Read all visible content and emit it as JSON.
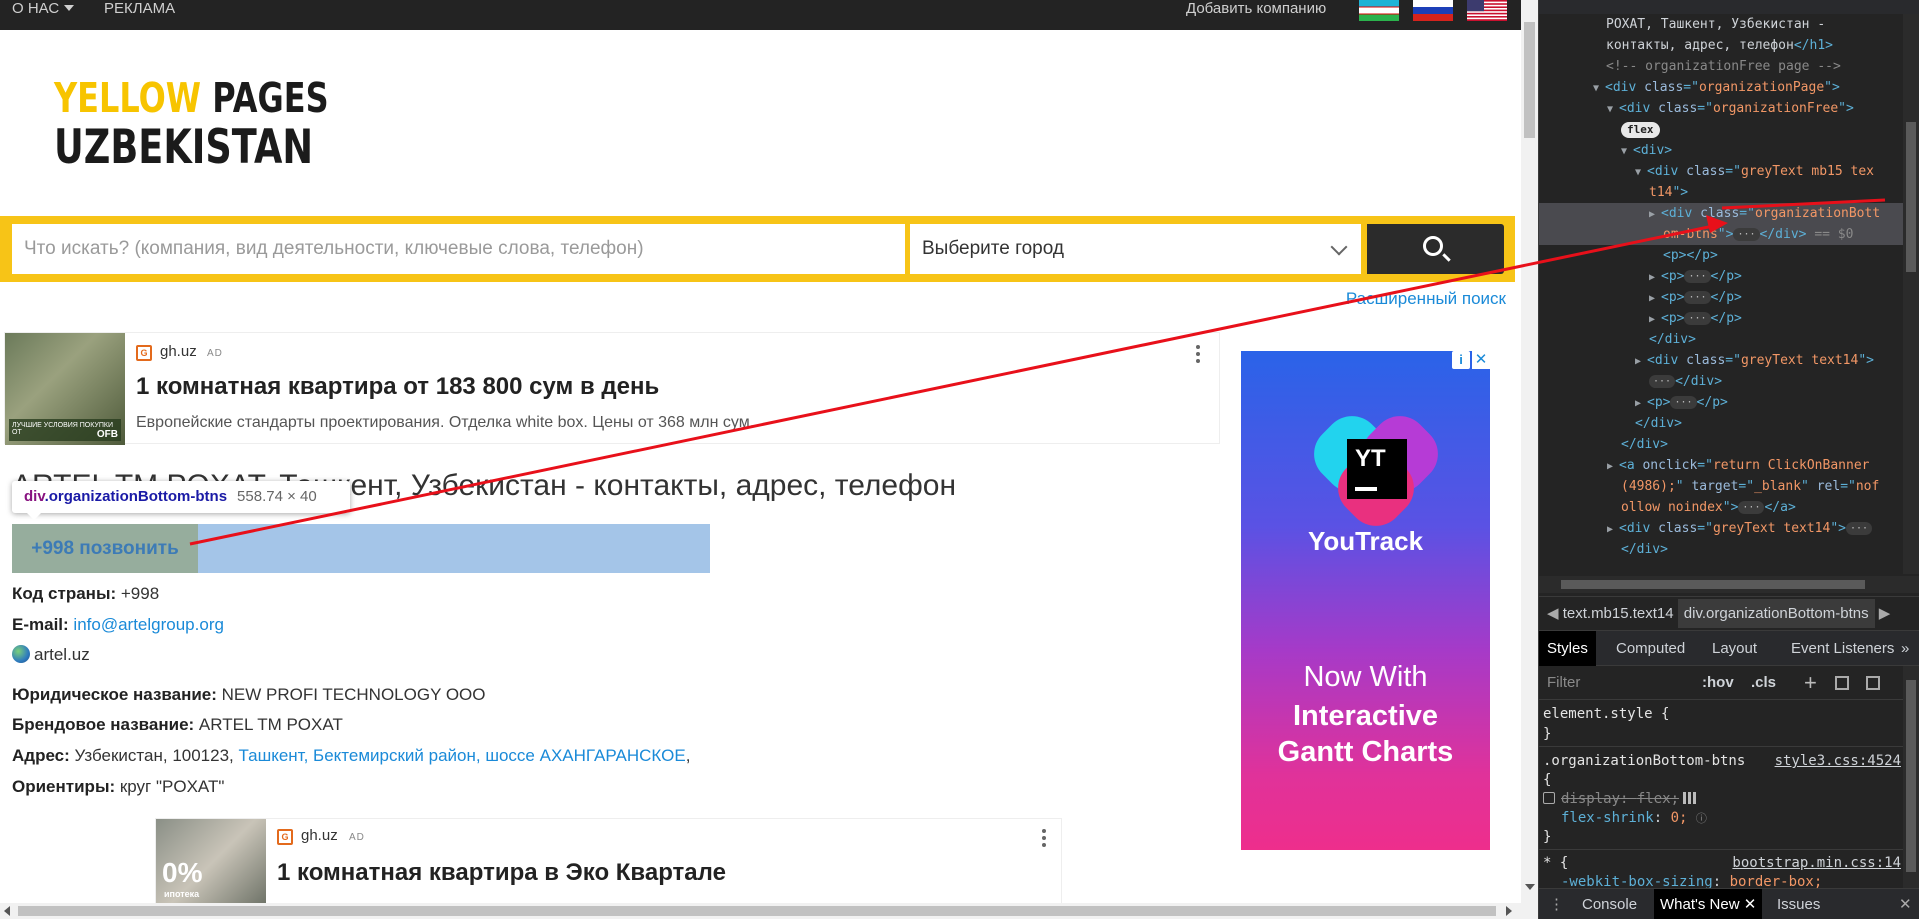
{
  "topbar": {
    "nav_about": "О НАС",
    "nav_ads": "РЕКЛАМА",
    "add_company": "Добавить компанию"
  },
  "logo": {
    "line1_a": "YELLOW",
    "line1_b": "PAGES",
    "line2": "UZBEKISTAN"
  },
  "search": {
    "placeholder": "Что искать? (компания, вид деятельности, ключевые слова, телефон)",
    "city_placeholder": "Выберите город",
    "advanced": "Расширенный поиск"
  },
  "ad_top": {
    "domain": "gh.uz",
    "ad_tag": "AD",
    "title": "1 комнатная квартира от 183 800 сум в день",
    "description": "Европейские стандарты проектирования. Отделка white box. Цены от 368 млн сум.",
    "thumb_caption": "ЛУЧШИЕ УСЛОВИЯ ПОКУПКИ ОТ",
    "thumb_brand": "OFB"
  },
  "company": {
    "heading": "ARTEL TM POXAT, Ташкент, Узбекистан - контакты, адрес, телефон",
    "call_button": "+998 позвонить",
    "country_code_label": "Код страны:",
    "country_code_value": "+998",
    "email_label": "E-mail:",
    "email_value": "info@artelgroup.org",
    "website": "artel.uz",
    "legal_name_label": "Юридическое название:",
    "legal_name_value": "NEW PROFI TECHNOLOGY OOO",
    "brand_name_label": "Брендовое название:",
    "brand_name_value": "ARTEL TM POXAT",
    "address_label": "Адрес:",
    "address_prefix": "Узбекистан, 100123,",
    "address_city": "Ташкент,",
    "address_district": "Бектемирский район,",
    "address_street": "шоссе АХАНГАРАНСКОЕ",
    "address_suffix": ",",
    "landmarks_label": "Ориентиры:",
    "landmarks_value": "круг \"POXAT\""
  },
  "tooltip": {
    "tag": "div",
    "cls": ".organizationBottom-btns",
    "size": "558.74 × 40"
  },
  "ad_bottom": {
    "domain": "gh.uz",
    "ad_tag": "AD",
    "title": "1 комнатная квартира в Эко Квартале",
    "thumb_big": "0%",
    "thumb_small": "ипотека"
  },
  "side_ad": {
    "info": "i",
    "close": "✕",
    "logo_text": "YT",
    "product": "YouTrack",
    "tag1": "Now With",
    "tag2a": "Interactive",
    "tag2b": "Gantt Charts"
  },
  "devtools": {
    "dom": [
      {
        "t": "POXAT, Ташкент, Узбекистан -"
      },
      {
        "t": "контакты, адрес, телефон"
      },
      {
        "t": "<!-- organizationFree page -->"
      },
      {
        "t": "organizationPage"
      },
      {
        "t": "organizationFree"
      },
      {
        "t": "flex"
      },
      {
        "t": "greyText mb15 tex"
      },
      {
        "t": "t14"
      },
      {
        "t": "organizationBott"
      },
      {
        "t": "om-btns"
      },
      {
        "t": "== $0"
      },
      {
        "t": "greyText text14"
      },
      {
        "t": "return ClickOnBanner"
      },
      {
        "t": "(4986);"
      },
      {
        "t": "_blank"
      },
      {
        "t": "nof"
      },
      {
        "t": "ollow noindex"
      }
    ],
    "crumb1": "text.mb15.text14",
    "crumb2": "div.organizationBottom-btns",
    "tabs": [
      "Styles",
      "Computed",
      "Layout",
      "Event Listeners",
      "»"
    ],
    "filter_placeholder": "Filter",
    "hov": ":hov",
    "cls": ".cls",
    "rules": {
      "element_style": "element.style {",
      "close": "}",
      "selector": ".organizationBottom-btns",
      "source1": "style3.css:4524",
      "open": "{",
      "prop1": "display",
      "val1": "flex;",
      "prop2": "flex-shrink",
      "val2": "0;",
      "selector2": "* {",
      "source2": "bootstrap.min.css:14",
      "prop3": "-webkit-box-sizing",
      "val3": "border-box;"
    },
    "drawer": {
      "console": "Console",
      "whats_new": "What's New",
      "issues": "Issues"
    }
  },
  "colors": {
    "brand_yellow": "#f7c417",
    "link_blue": "#1a8ad8",
    "highlight_blue": "#a4c5e8",
    "highlight_green": "#96ad9d",
    "annotation_red": "#e8101a"
  }
}
